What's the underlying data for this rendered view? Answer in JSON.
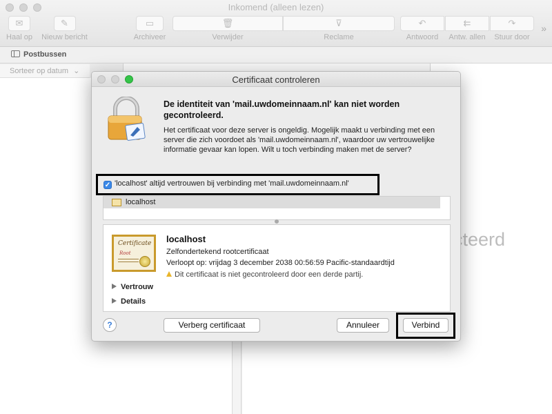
{
  "window": {
    "title": "Inkomend (alleen lezen)",
    "toolbar": {
      "haal_op": "Haal op",
      "nieuw_bericht": "Nieuw bericht",
      "archiveer": "Archiveer",
      "verwijder": "Verwijder",
      "reclame": "Reclame",
      "antwoord": "Antwoord",
      "antw_allen": "Antw. allen",
      "stuur_door": "Stuur door",
      "more": "»"
    },
    "favorites": {
      "postbussen": "Postbussen"
    },
    "sort_label": "Sorteer op datum",
    "sort_chevron": "⌄",
    "preview_bg_text": "cteerd"
  },
  "dialog": {
    "title": "Certificaat controleren",
    "heading": "De identiteit van 'mail.uwdomeinnaam.nl' kan niet worden gecontroleerd.",
    "body": "Het certificaat voor deze server is ongeldig. Mogelijk maakt u verbinding met een server die zich voordoet als 'mail.uwdomeinnaam.nl', waardoor uw vertrouwelijke informatie gevaar kan lopen. Wilt u toch verbinding maken met de server?",
    "trust_checkbox": {
      "label": "'localhost' altijd vertrouwen bij verbinding met 'mail.uwdomeinnaam.nl'",
      "checked": true
    },
    "cert_list": [
      "localhost"
    ],
    "cert_image": {
      "title": "Certificate",
      "subtitle": "Root"
    },
    "cert_detail": {
      "name": "localhost",
      "type": "Zelfondertekend rootcertificaat",
      "expires": "Verloopt op: vrijdag 3 december 2038 00:56:59 Pacific-standaardtijd",
      "warning": "Dit certificaat is niet gecontroleerd door een derde partij.",
      "sections": [
        "Vertrouw",
        "Details"
      ]
    },
    "buttons": {
      "help": "?",
      "hide_cert": "Verberg certificaat",
      "cancel": "Annuleer",
      "connect": "Verbind"
    }
  },
  "colors": {
    "accent": "#3b89e8",
    "warning": "#e9b52b",
    "close_light": "#d3d3d3",
    "zoom_light": "#35c449"
  }
}
